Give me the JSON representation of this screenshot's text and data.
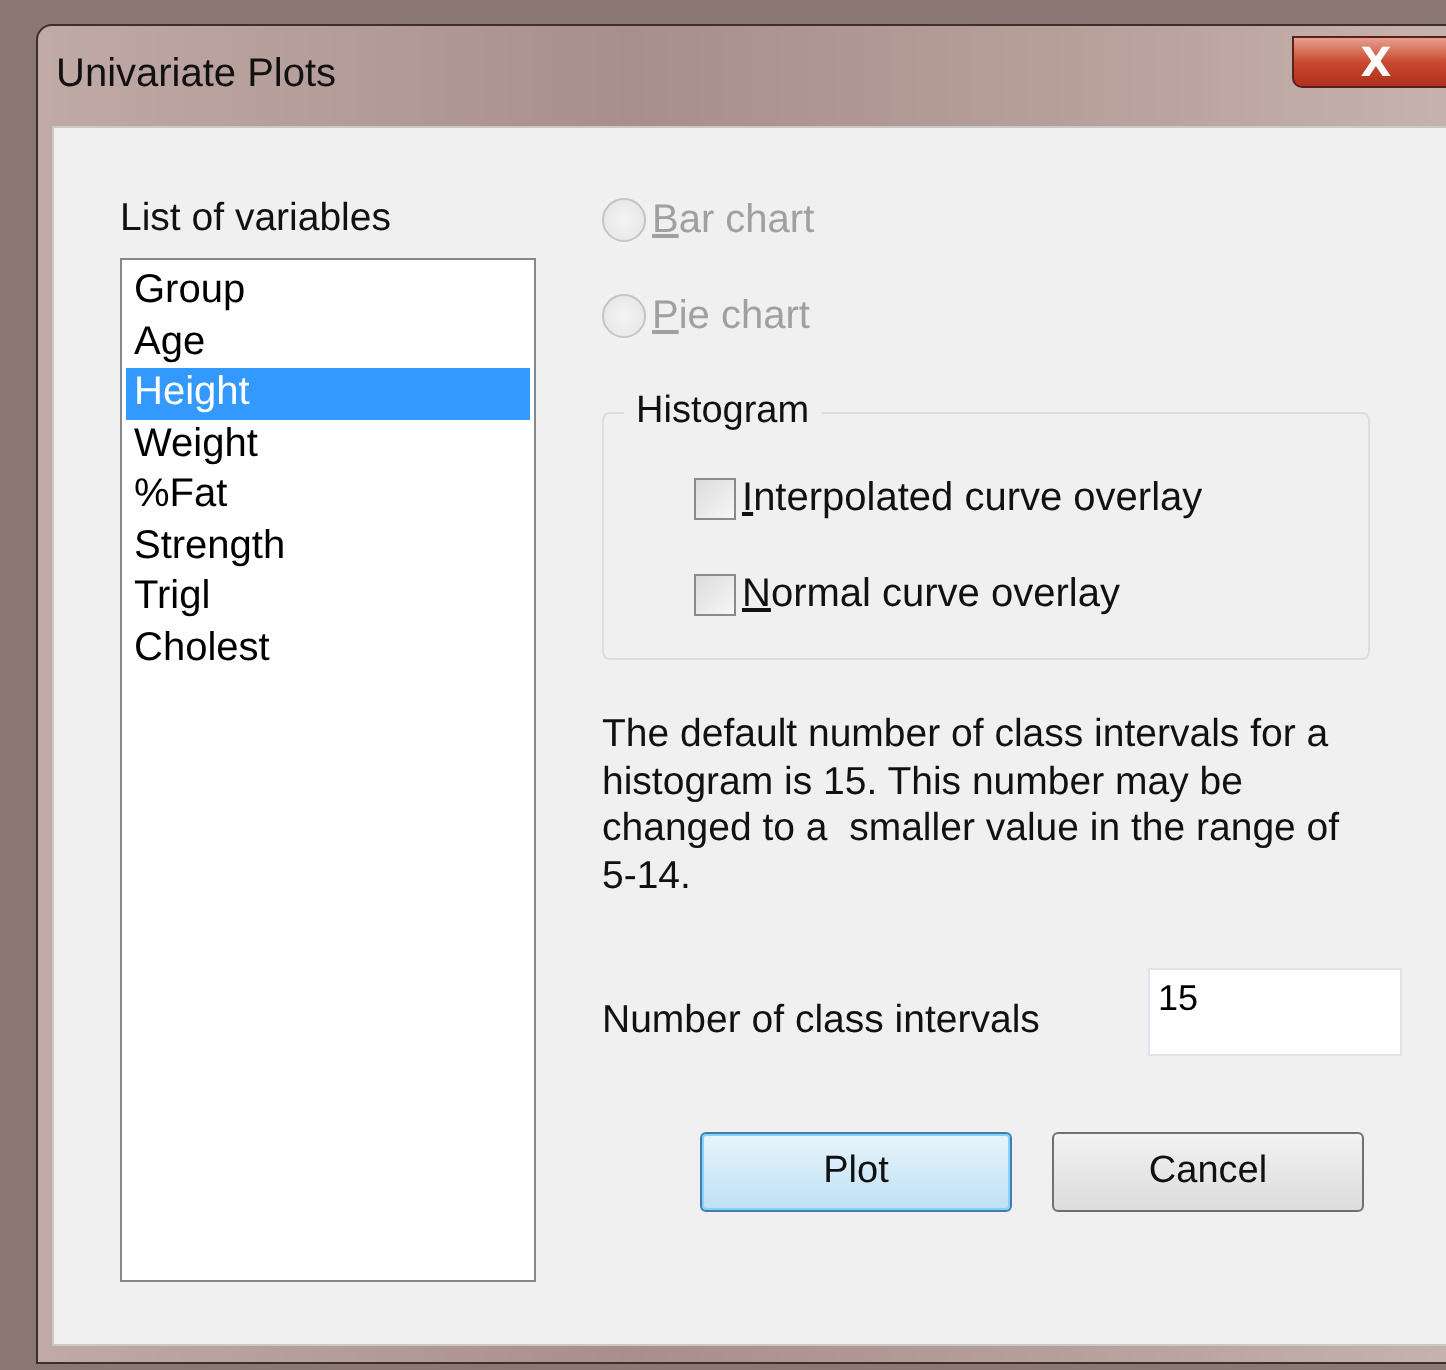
{
  "window": {
    "title": "Univariate Plots",
    "close_label": "X"
  },
  "variables": {
    "label": "List of variables",
    "items": [
      {
        "label": "Group",
        "selected": false
      },
      {
        "label": "Age",
        "selected": false
      },
      {
        "label": "Height",
        "selected": true
      },
      {
        "label": "Weight",
        "selected": false
      },
      {
        "label": "%Fat",
        "selected": false
      },
      {
        "label": "Strength",
        "selected": false
      },
      {
        "label": "Trigl",
        "selected": false
      },
      {
        "label": "Cholest",
        "selected": false
      }
    ]
  },
  "chart_types": [
    {
      "label": "Bar chart",
      "selected": false,
      "disabled": true,
      "underline_first": true
    },
    {
      "label": "Pie chart",
      "selected": false,
      "disabled": true,
      "underline_first": true
    }
  ],
  "histogram": {
    "title": "Histogram",
    "options": [
      {
        "label": "Interpolated curve overlay",
        "checked": false,
        "underline_first": true
      },
      {
        "label": "Normal curve overlay",
        "checked": false,
        "underline_first": true
      }
    ]
  },
  "note": "The default number of class intervals for a histogram is 15. This number may be changed to a  smaller value in the range of 5-14.",
  "intervals": {
    "label": "Number of class intervals",
    "value": "15"
  },
  "buttons": [
    {
      "label": "Plot",
      "default": true
    },
    {
      "label": "Cancel",
      "default": false
    }
  ]
}
